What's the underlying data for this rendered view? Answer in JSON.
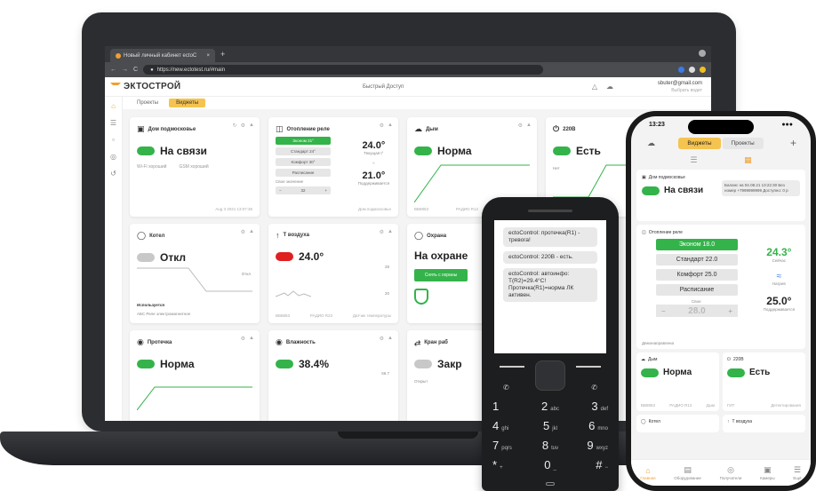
{
  "browser": {
    "tab_title": "Новый личный кабинет ectoC",
    "tab_close": "×",
    "new_tab": "+",
    "url": "https://new.ectotest.ru/#main",
    "nav_back": "←",
    "nav_forward": "→",
    "nav_reload": "C"
  },
  "app": {
    "logo": "ЭКТОСТРОЙ",
    "quick_access": "Быстрый Доступ",
    "user_email": "sbuter@gmail.com",
    "user_sub": "Выбрать водит",
    "tabs": [
      "Проекты",
      "Виджеты"
    ]
  },
  "widgets": {
    "home": {
      "title": "Дом подмосковье",
      "status": "На связи",
      "wifi": "Wi-Fi",
      "wifi_state": "хороший",
      "gsm": "GSM",
      "gsm_state": "хороший",
      "footer_left": "",
      "footer_right": "Aug 3 2021 13:07:36"
    },
    "relay": {
      "title": "Отопление реле",
      "modes": [
        "Эконом 21°",
        "Стандарт 24°",
        "Комфорт 30°",
        "Расписание"
      ],
      "save_label": "Свое значение",
      "stepper_minus": "−",
      "stepper_value": "32",
      "stepper_plus": "+",
      "current": "24.0°",
      "current_label": "Текущая t°",
      "target": "21.0°",
      "target_label": "Поддерживается",
      "footer_right": "Дом подмосковье"
    },
    "smoke": {
      "title": "Дым",
      "status": "Норма",
      "footer_left": "ВВ8853",
      "footer_mid": "РАДИО R12",
      "footer_right": "Датчик дыма"
    },
    "v220": {
      "title": "220В",
      "status": "Есть",
      "side_label": "Нет"
    },
    "boiler": {
      "title": "Котел",
      "status": "Откл",
      "chart_label": "Откл",
      "used": "Используется",
      "used_items": "АБС  Реле электромагнитное"
    },
    "air": {
      "title": "Т воздуха",
      "status": "24.0°",
      "axis_top": "28",
      "axis_bottom": "20",
      "footer_left": "ВВ8853",
      "footer_mid": "РАДИО R23",
      "footer_right": "Датчик температуры"
    },
    "guard": {
      "title": "Охрана",
      "status": "На охране",
      "button": "Снять с охраны"
    },
    "leak": {
      "title": "Протечка",
      "status": "Норма"
    },
    "humidity": {
      "title": "Влажность",
      "status": "38.4%",
      "axis_top": "56.7"
    },
    "valve": {
      "title": "Кран раб",
      "status": "Закр",
      "side_label": "Открыт"
    }
  },
  "sms": [
    "ectoControl: протечка(R1) - тревога!",
    "ectoControl: 220В - есть.",
    "ectoControl: автоинфо: T(R2)=29.4°C! Протечка(R1)=норма ЛК активен."
  ],
  "keypad": [
    {
      "d": "1",
      "l": ""
    },
    {
      "d": "2",
      "l": "abc"
    },
    {
      "d": "3",
      "l": "def"
    },
    {
      "d": "4",
      "l": "ghi"
    },
    {
      "d": "5",
      "l": "jkl"
    },
    {
      "d": "6",
      "l": "mno"
    },
    {
      "d": "7",
      "l": "pqrs"
    },
    {
      "d": "8",
      "l": "tuv"
    },
    {
      "d": "9",
      "l": "wxyz"
    },
    {
      "d": "*",
      "l": "+"
    },
    {
      "d": "0",
      "l": "_"
    },
    {
      "d": "#",
      "l": "−"
    }
  ],
  "mobile": {
    "time": "13:23",
    "seg_widgets": "Виджеты",
    "seg_projects": "Проекты",
    "plus": "+",
    "home_title": "Дом подмосковье",
    "home_status": "На связи",
    "home_bubble": "Баланс на 04.08.21 13:22:30 Без номер +7999999999 Доступно: 0 р",
    "relay_title": "Отопление реле",
    "modes": [
      "Эконом 18.0",
      "Стандарт 22.0",
      "Комфорт 25.0",
      "Расписание"
    ],
    "current": "24.3°",
    "current_label": "Сейчас",
    "heat_label": "Нагрев",
    "save_label": "Свое",
    "stepper_value": "28.0",
    "stepper_minus": "−",
    "stepper_plus": "+",
    "target": "25.0°",
    "target_label": "Поддерживается",
    "relay_footer": "Демонаправлена",
    "smoke_title": "Дым",
    "smoke_status": "Норма",
    "smoke_footer_left": "ВВ8853",
    "smoke_footer_mid": "РАДИО R12",
    "smoke_footer_right": "Дым",
    "v220_title": "220В",
    "v220_status": "Есть",
    "v220_footer_left": "ГИТ",
    "v220_footer_right": "Детектирования",
    "boiler_title": "Котел",
    "air_title": "Т воздуха",
    "tabs": [
      "Главная",
      "Оборудование",
      "Получатели",
      "Камеры",
      "Ещё"
    ]
  }
}
